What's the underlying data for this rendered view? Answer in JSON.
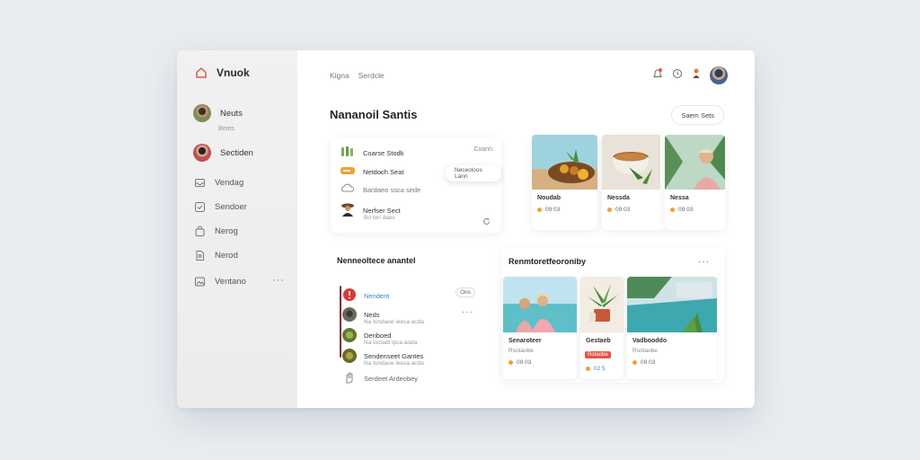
{
  "sidebar": {
    "brand": "Vnuok",
    "items": [
      {
        "label": "Neuts",
        "sub": "Beats"
      },
      {
        "label": "Sectiden"
      },
      {
        "label": "Vendag"
      },
      {
        "label": "Sendoer"
      },
      {
        "label": "Nerog"
      },
      {
        "label": "Nerod"
      },
      {
        "label": "Ventano"
      }
    ],
    "more": "···"
  },
  "header": {
    "crumbs": [
      "Kigna",
      "Serdcle"
    ],
    "title": "Nananoil Santis",
    "button": "Saem Sets"
  },
  "list_card": {
    "tag": "Coann",
    "rows": [
      {
        "label": "Coarse Stodk"
      },
      {
        "label": "Netdoch Seat"
      },
      {
        "label": "Bardaeo ssca sede"
      },
      {
        "label": "Nerfser Sect",
        "sub": "Bo tori daes"
      }
    ],
    "popup": "Neceoloos Lann"
  },
  "photo_cards": [
    {
      "title": "Noudab",
      "meta": "09 03"
    },
    {
      "title": "Nessda",
      "meta": "09 03"
    },
    {
      "title": "Nessa",
      "meta": "09 03"
    }
  ],
  "feed": {
    "title": "Nenneoltece anantel",
    "chip": "Ons",
    "more": "···",
    "rows": [
      {
        "label": "Nendent"
      },
      {
        "label": "Neds",
        "sub": "Na tondaoe ieesa acda"
      },
      {
        "label": "Denboed",
        "sub": "Na loctadt ipca aoda"
      },
      {
        "label": "Sendenseet Gantes",
        "sub": "Na tondaoe ieesa acda"
      },
      {
        "label": "Serdeet Ardeobey"
      }
    ]
  },
  "gallery": {
    "title": "Renmtoretfeoroniby",
    "more": "···",
    "cards": [
      {
        "title": "Senaroteer",
        "sub": "Rsotaobe",
        "meta": "09 03"
      },
      {
        "title": "Gestaeb",
        "sub": "Rotaobe",
        "meta": "02 5"
      },
      {
        "title": "Vadbooddo",
        "sub": "Rsotaobe",
        "meta": "09 03"
      }
    ]
  },
  "colors": {
    "accent_red": "#e25545",
    "accent_orange": "#f0a030",
    "link_blue": "#3b82c4"
  }
}
